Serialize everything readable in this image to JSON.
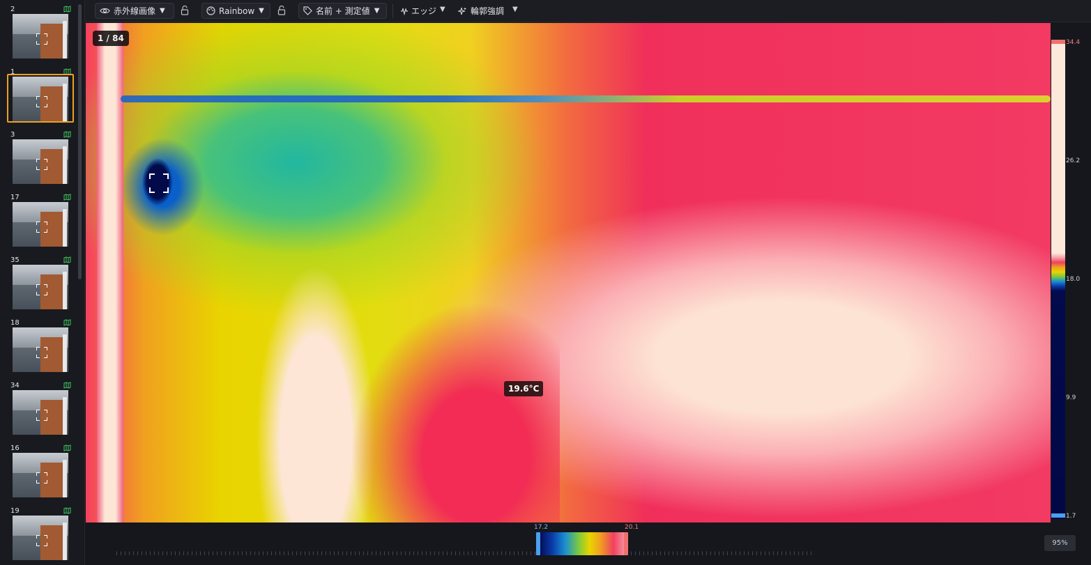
{
  "sidebar": {
    "items": [
      {
        "num": "2",
        "selected": false
      },
      {
        "num": "1",
        "selected": true
      },
      {
        "num": "3",
        "selected": false
      },
      {
        "num": "17",
        "selected": false
      },
      {
        "num": "35",
        "selected": false
      },
      {
        "num": "18",
        "selected": false
      },
      {
        "num": "34",
        "selected": false
      },
      {
        "num": "16",
        "selected": false
      },
      {
        "num": "19",
        "selected": false
      }
    ],
    "selected_border_color": "#f0a020",
    "map_icon": "map-icon"
  },
  "toolbar": {
    "view_mode_label": "赤外線画像",
    "palette_label": "Rainbow",
    "label_mode_label": "名前 + 測定値",
    "edge_label": "エッジ",
    "contour_label": "輪郭強調"
  },
  "viewer": {
    "counter": "1 / 84",
    "spot_temperature": "19.6°C",
    "palette": "Rainbow"
  },
  "scale": {
    "max": "34.4",
    "t2": "26.2",
    "t3": "18.0",
    "t4": "9.9",
    "min": "1.7"
  },
  "histogram": {
    "range_low": "17.2",
    "range_high": "20.1",
    "zoom": "95%"
  },
  "colors": {
    "accent_selected": "#f0a020",
    "scale_high": "#f07070",
    "scale_low": "#4a9ff0"
  }
}
